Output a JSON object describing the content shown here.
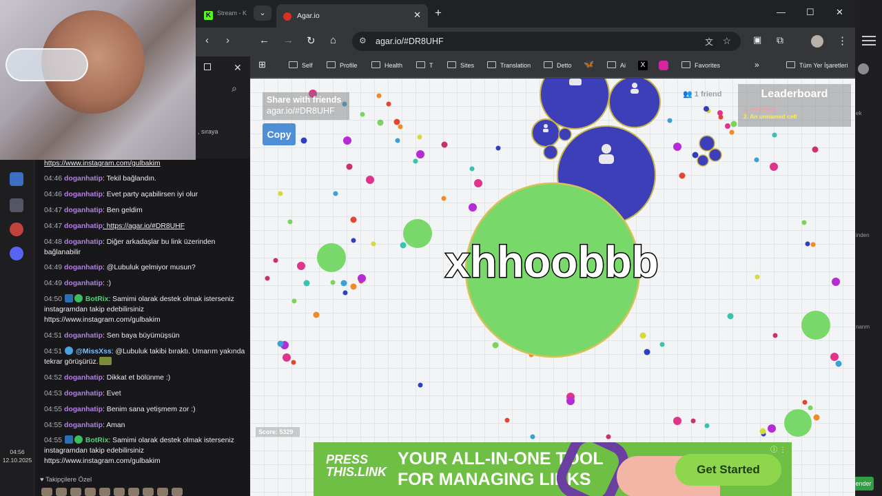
{
  "background_window": {
    "tab_label": "Stream - K",
    "partial_text": ", sıraya"
  },
  "browser": {
    "tab_title": "Agar.io",
    "url": "agar.io/#DR8UHF",
    "bookmarks": [
      "Self",
      "Profile",
      "Health",
      "T",
      "Sites",
      "Translation",
      "Detto",
      "Ai",
      "Favorites",
      "Tüm Yer İşaretleri"
    ]
  },
  "game": {
    "share_title": "Share with friends",
    "share_link": "agar.io/#DR8UHF",
    "copy_label": "Copy",
    "friends": "1 friend",
    "leaderboard_title": "Leaderboard",
    "leaderboard": [
      "1. xhhoobbb",
      "2. An unnamed cell"
    ],
    "player_name": "xhhoobbb",
    "score": "Score: 5329",
    "colors": {
      "player": "#78d86a",
      "enemy": "#3d3fb8",
      "background": "#f2f4f6"
    }
  },
  "ad": {
    "brand_1": "PRESS",
    "brand_2": "THIS.LINK",
    "headline_1": "YOUR ALL-IN-ONE TOOL",
    "headline_2": "FOR MANAGING LINKS",
    "cta": "Get Started"
  },
  "chat": {
    "top_link": "https://www.instagram.com/gulbakim",
    "messages": [
      {
        "time": "04:46",
        "user": "doganhatip",
        "text": ": Tekil bağlandın."
      },
      {
        "time": "04:46",
        "user": "doganhatip",
        "text": ": Evet party açabilirsen iyi olur"
      },
      {
        "time": "04:47",
        "user": "doganhatip",
        "text": ": Ben geldim"
      },
      {
        "time": "04:47",
        "user": "doganhatip",
        "text": ": https://agar.io/#DR8UHF"
      },
      {
        "time": "04:48",
        "user": "doganhatip",
        "text": ": Diğer arkadaşlar bu link üzerinden bağlanabilir"
      },
      {
        "time": "04:49",
        "user": "doganhatip",
        "text": ": @Lubuluk gelmiyor musun?"
      },
      {
        "time": "04:49",
        "user": "doganhatip",
        "text": ": :)"
      },
      {
        "time": "04:50",
        "user": "BotRix",
        "text": ": Samimi olarak destek olmak isterseniz instagramdan takip edebilirsiniz https://www.instagram.com/gulbakim"
      },
      {
        "time": "04:51",
        "user": "doganhatip",
        "text": ": Sen baya büyümüşsün"
      },
      {
        "time": "04:51",
        "user": "@MissXss",
        "text": ": @Lubuluk takibi bıraktı. Umarım yakında tekrar görüşürüz."
      },
      {
        "time": "04:52",
        "user": "doganhatip",
        "text": ": Dikkat et bölünme :)"
      },
      {
        "time": "04:53",
        "user": "doganhatip",
        "text": ": Evet"
      },
      {
        "time": "04:55",
        "user": "doganhatip",
        "text": ": Benim sana yetişmem zor :)"
      },
      {
        "time": "04:55",
        "user": "doganhatip",
        "text": ": Aman"
      },
      {
        "time": "04:55",
        "user": "BotRix",
        "text": ": Samimi olarak destek olmak isterseniz instagramdan takip edebilirsiniz https://www.instagram.com/gulbakim"
      }
    ],
    "footer": "♥ Takipçilere Özel"
  },
  "system": {
    "time": "04:56",
    "date": "12.10.2025"
  },
  "right_panel": {
    "texts": [
      "ek",
      "inden",
      "nanm"
    ],
    "button": "ender"
  }
}
